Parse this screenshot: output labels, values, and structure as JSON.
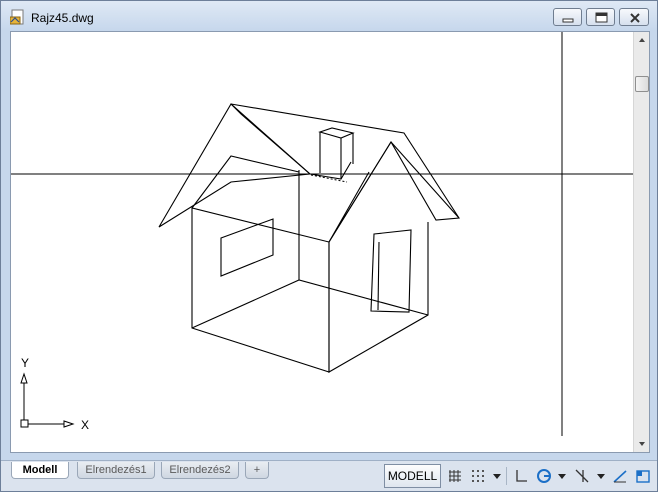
{
  "window": {
    "title": "Rajz45.dwg"
  },
  "colors": {
    "titlebar": "#c6d7ec",
    "canvas": "#ffffff",
    "linework": "#000000",
    "statusbar": "#dbe3ee"
  },
  "icons": {
    "app": "dwg-file-icon",
    "minimize": "minimize-icon",
    "maximize": "maximize-icon",
    "close": "close-icon",
    "ucs": "ucs-axis-icon",
    "grid": "grid-display-icon",
    "snap": "snap-mode-icon",
    "ortho": "ortho-mode-icon",
    "polar": "polar-tracking-icon",
    "osnap": "object-snap-icon",
    "tracking": "object-snap-tracking-icon",
    "viewport": "viewport-icon"
  },
  "ucs": {
    "x_label": "X",
    "y_label": "Y"
  },
  "tabs": {
    "model": "Modell",
    "layout1": "Elrendezés1",
    "layout2": "Elrendezés2",
    "add": "+"
  },
  "status": {
    "model_button": "MODELL"
  }
}
